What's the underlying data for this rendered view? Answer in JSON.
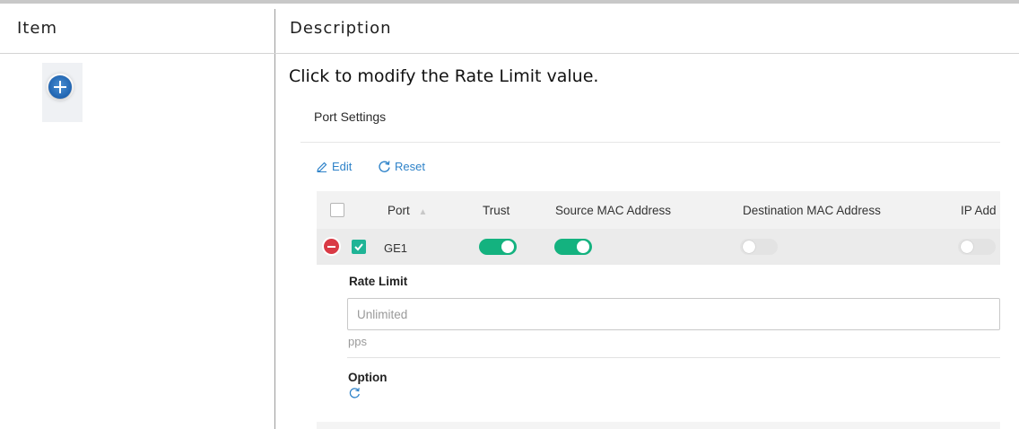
{
  "table": {
    "header_item": "Item",
    "header_description": "Description",
    "row_description": "Click to modify the Rate Limit value."
  },
  "screenshot": {
    "title": "Port Settings",
    "toolbar": {
      "edit_label": "Edit",
      "reset_label": "Reset"
    },
    "columns": [
      "Port",
      "Trust",
      "Source MAC Address",
      "Destination MAC Address",
      "IP Add"
    ],
    "row": {
      "port": "GE1",
      "selected": true,
      "trust": true,
      "source_mac": true,
      "destination_mac": false,
      "ip_address": false
    },
    "rate_limit": {
      "label": "Rate Limit",
      "placeholder": "Unlimited",
      "unit": "pps"
    },
    "option": {
      "label": "Option"
    }
  },
  "colors": {
    "accent_blue": "#2f83c9",
    "toggle_on": "#14b27f",
    "checkbox_on": "#1fb496",
    "remove_red": "#d93a45",
    "add_blue": "#1f63b0"
  },
  "icons": [
    "add-circle-icon",
    "edit-pencil-icon",
    "reset-icon",
    "sort-icon",
    "remove-circle-icon",
    "refresh-icon"
  ]
}
